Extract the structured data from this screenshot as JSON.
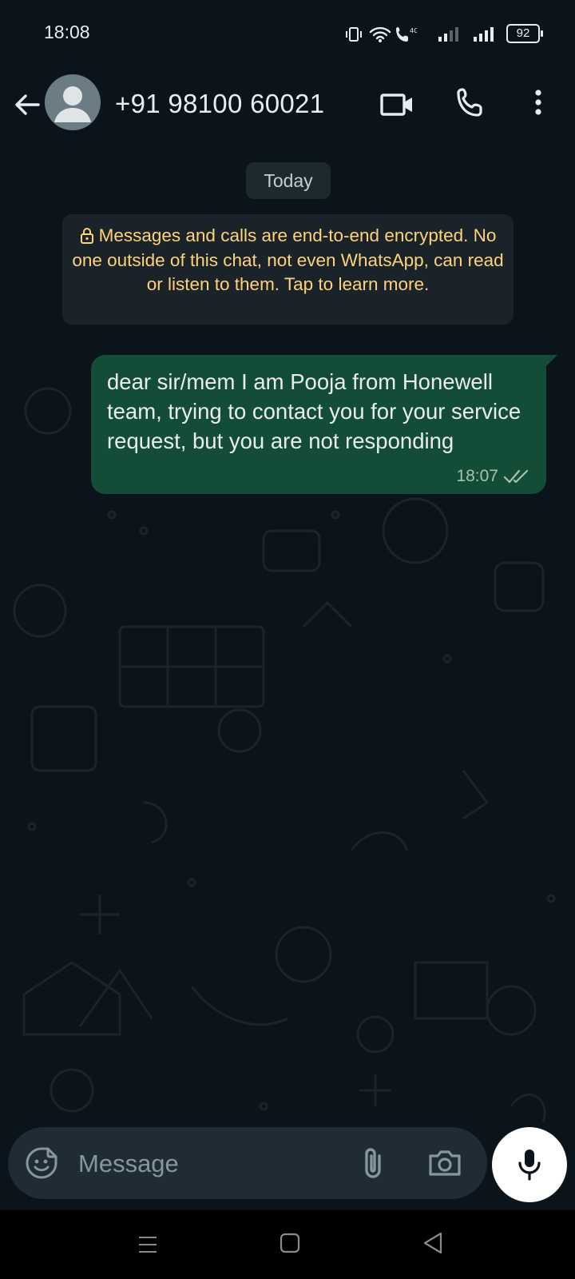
{
  "status_bar": {
    "time": "18:08",
    "battery": "92"
  },
  "header": {
    "contact_name": "+91 98100 60021",
    "icons": [
      "back-arrow-icon",
      "avatar-placeholder-icon",
      "video-call-icon",
      "phone-icon",
      "more-vertical-icon"
    ]
  },
  "chat": {
    "date_chip": "Today",
    "encryption_notice": "Messages and calls are end-to-end encrypted. No one outside of this chat, not even WhatsApp, can read or listen to them. Tap to learn more.",
    "messages": [
      {
        "direction": "outgoing",
        "text": "dear sir/mem I am Pooja from Honewell team, trying to contact you for your service request, but you are not responding",
        "time": "18:07",
        "status": "delivered-double-tick"
      }
    ]
  },
  "composer": {
    "placeholder": "Message",
    "icons": [
      "emoji-sticker-icon",
      "attach-icon",
      "camera-icon",
      "mic-icon"
    ]
  },
  "colors": {
    "background": "#0b141a",
    "outgoing_bubble": "#144d37",
    "notice_text": "#ffd279",
    "input_bar": "#1f2c34"
  }
}
